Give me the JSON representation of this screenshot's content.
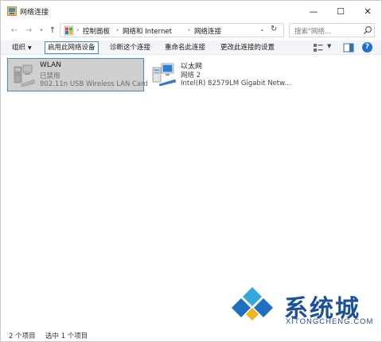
{
  "window": {
    "title": "网络连接",
    "min_glyph": "—",
    "max_glyph": "☐",
    "close_glyph": "✕"
  },
  "address": {
    "back_glyph": "←",
    "forward_glyph": "→",
    "recent_glyph": "▾",
    "up_glyph": "↑",
    "separator": "›",
    "crumbs": [
      "控制面板",
      "网络和 Internet",
      "网络连接"
    ],
    "dropdown_glyph": "⌄",
    "refresh_glyph": "↻"
  },
  "search": {
    "placeholder": "搜索\"网络...",
    "icon": "search-icon"
  },
  "toolbar": {
    "organize": "组织",
    "organize_caret": "▼",
    "enable": "启用此网络设备",
    "diagnose": "诊断这个连接",
    "rename": "重命名此连接",
    "change_settings": "更改此连接的设置",
    "view_caret": "▼",
    "help_glyph": "?"
  },
  "connections": [
    {
      "name": "WLAN",
      "status": "已禁用",
      "device": "802.11n USB Wireless LAN Card",
      "icon": "wlan-adapter-icon",
      "selected": true
    },
    {
      "name": "以太网",
      "status": "网络 2",
      "device": "Intel(R) 82579LM Gigabit Netw...",
      "icon": "ethernet-adapter-icon",
      "selected": false
    }
  ],
  "status": {
    "count": "2 个项目",
    "selected": "选中 1 个项目"
  },
  "watermark": {
    "text": "系统城",
    "sub": "XITONGCHENG.COM"
  },
  "colors": {
    "accent": "#3c8be0",
    "selection": "#cfcfcf",
    "watermark": "#1a4f9c",
    "help": "#1f6fd1"
  }
}
